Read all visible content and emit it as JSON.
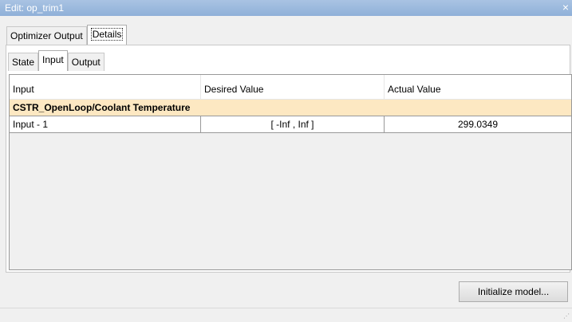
{
  "window": {
    "title": "Edit: op_trim1",
    "close_glyph": "×"
  },
  "top_tabs": [
    {
      "label": "Optimizer Output",
      "active": false
    },
    {
      "label": "Details",
      "active": true
    }
  ],
  "sub_tabs": [
    {
      "label": "State",
      "active": false
    },
    {
      "label": "Input",
      "active": true
    },
    {
      "label": "Output",
      "active": false
    }
  ],
  "table": {
    "columns": [
      "Input",
      "Desired Value",
      "Actual Value"
    ],
    "group_label": "CSTR_OpenLoop/Coolant Temperature",
    "rows": [
      {
        "name": "Input - 1",
        "desired": "[ -Inf , Inf ]",
        "actual": "299.0349"
      }
    ]
  },
  "footer": {
    "initialize_label": "Initialize model..."
  },
  "colors": {
    "titlebar": "#9bb9de",
    "group_row": "#fde8c2"
  }
}
